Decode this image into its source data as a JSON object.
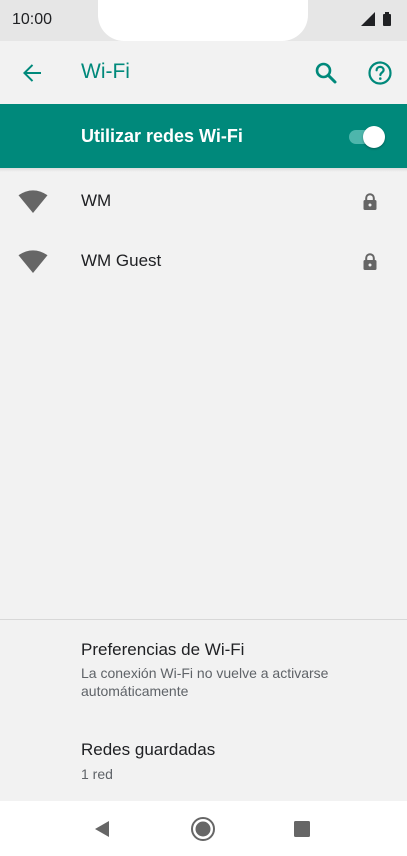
{
  "status_bar": {
    "time": "10:00",
    "icons": [
      "signal-icon",
      "battery-icon"
    ]
  },
  "app_bar": {
    "title": "Wi-Fi",
    "back_icon": "arrow-back-icon",
    "search_icon": "search-icon",
    "help_icon": "help-icon"
  },
  "master_switch": {
    "label": "Utilizar redes Wi-Fi",
    "on": true
  },
  "networks": [
    {
      "name": "WM",
      "secured": true
    },
    {
      "name": "WM Guest",
      "secured": true
    }
  ],
  "preferences": [
    {
      "title": "Preferencias de Wi-Fi",
      "subtitle": "La conexión Wi-Fi no vuelve a activarse automáticamente"
    },
    {
      "title": "Redes guardadas",
      "subtitle": "1 red"
    }
  ],
  "colors": {
    "accent": "#00897b",
    "background": "#f2f2f2"
  }
}
